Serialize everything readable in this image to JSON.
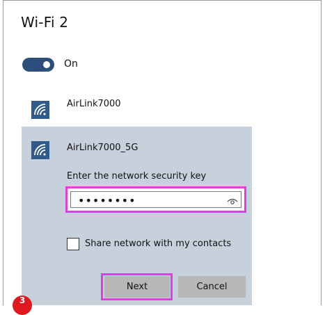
{
  "window": {
    "title": "Wi-Fi 2"
  },
  "toggle": {
    "state_label": "On"
  },
  "networks": [
    {
      "name": "AirLink7000"
    },
    {
      "name": "AirLink7000_5G"
    }
  ],
  "connect_form": {
    "prompt": "Enter the network security key",
    "password_masked": "••••••••",
    "share_label": "Share network with my contacts",
    "next_label": "Next",
    "cancel_label": "Cancel"
  },
  "annotation": {
    "badge_label": "3"
  },
  "colors": {
    "accent": "#2b4f7a",
    "highlight": "#e23ce2",
    "panel": "#c7d1db",
    "button": "#b7b7b7",
    "badge": "#e0191e"
  },
  "icons": {
    "wifi": "wifi-signal-icon",
    "reveal": "eye-icon"
  }
}
